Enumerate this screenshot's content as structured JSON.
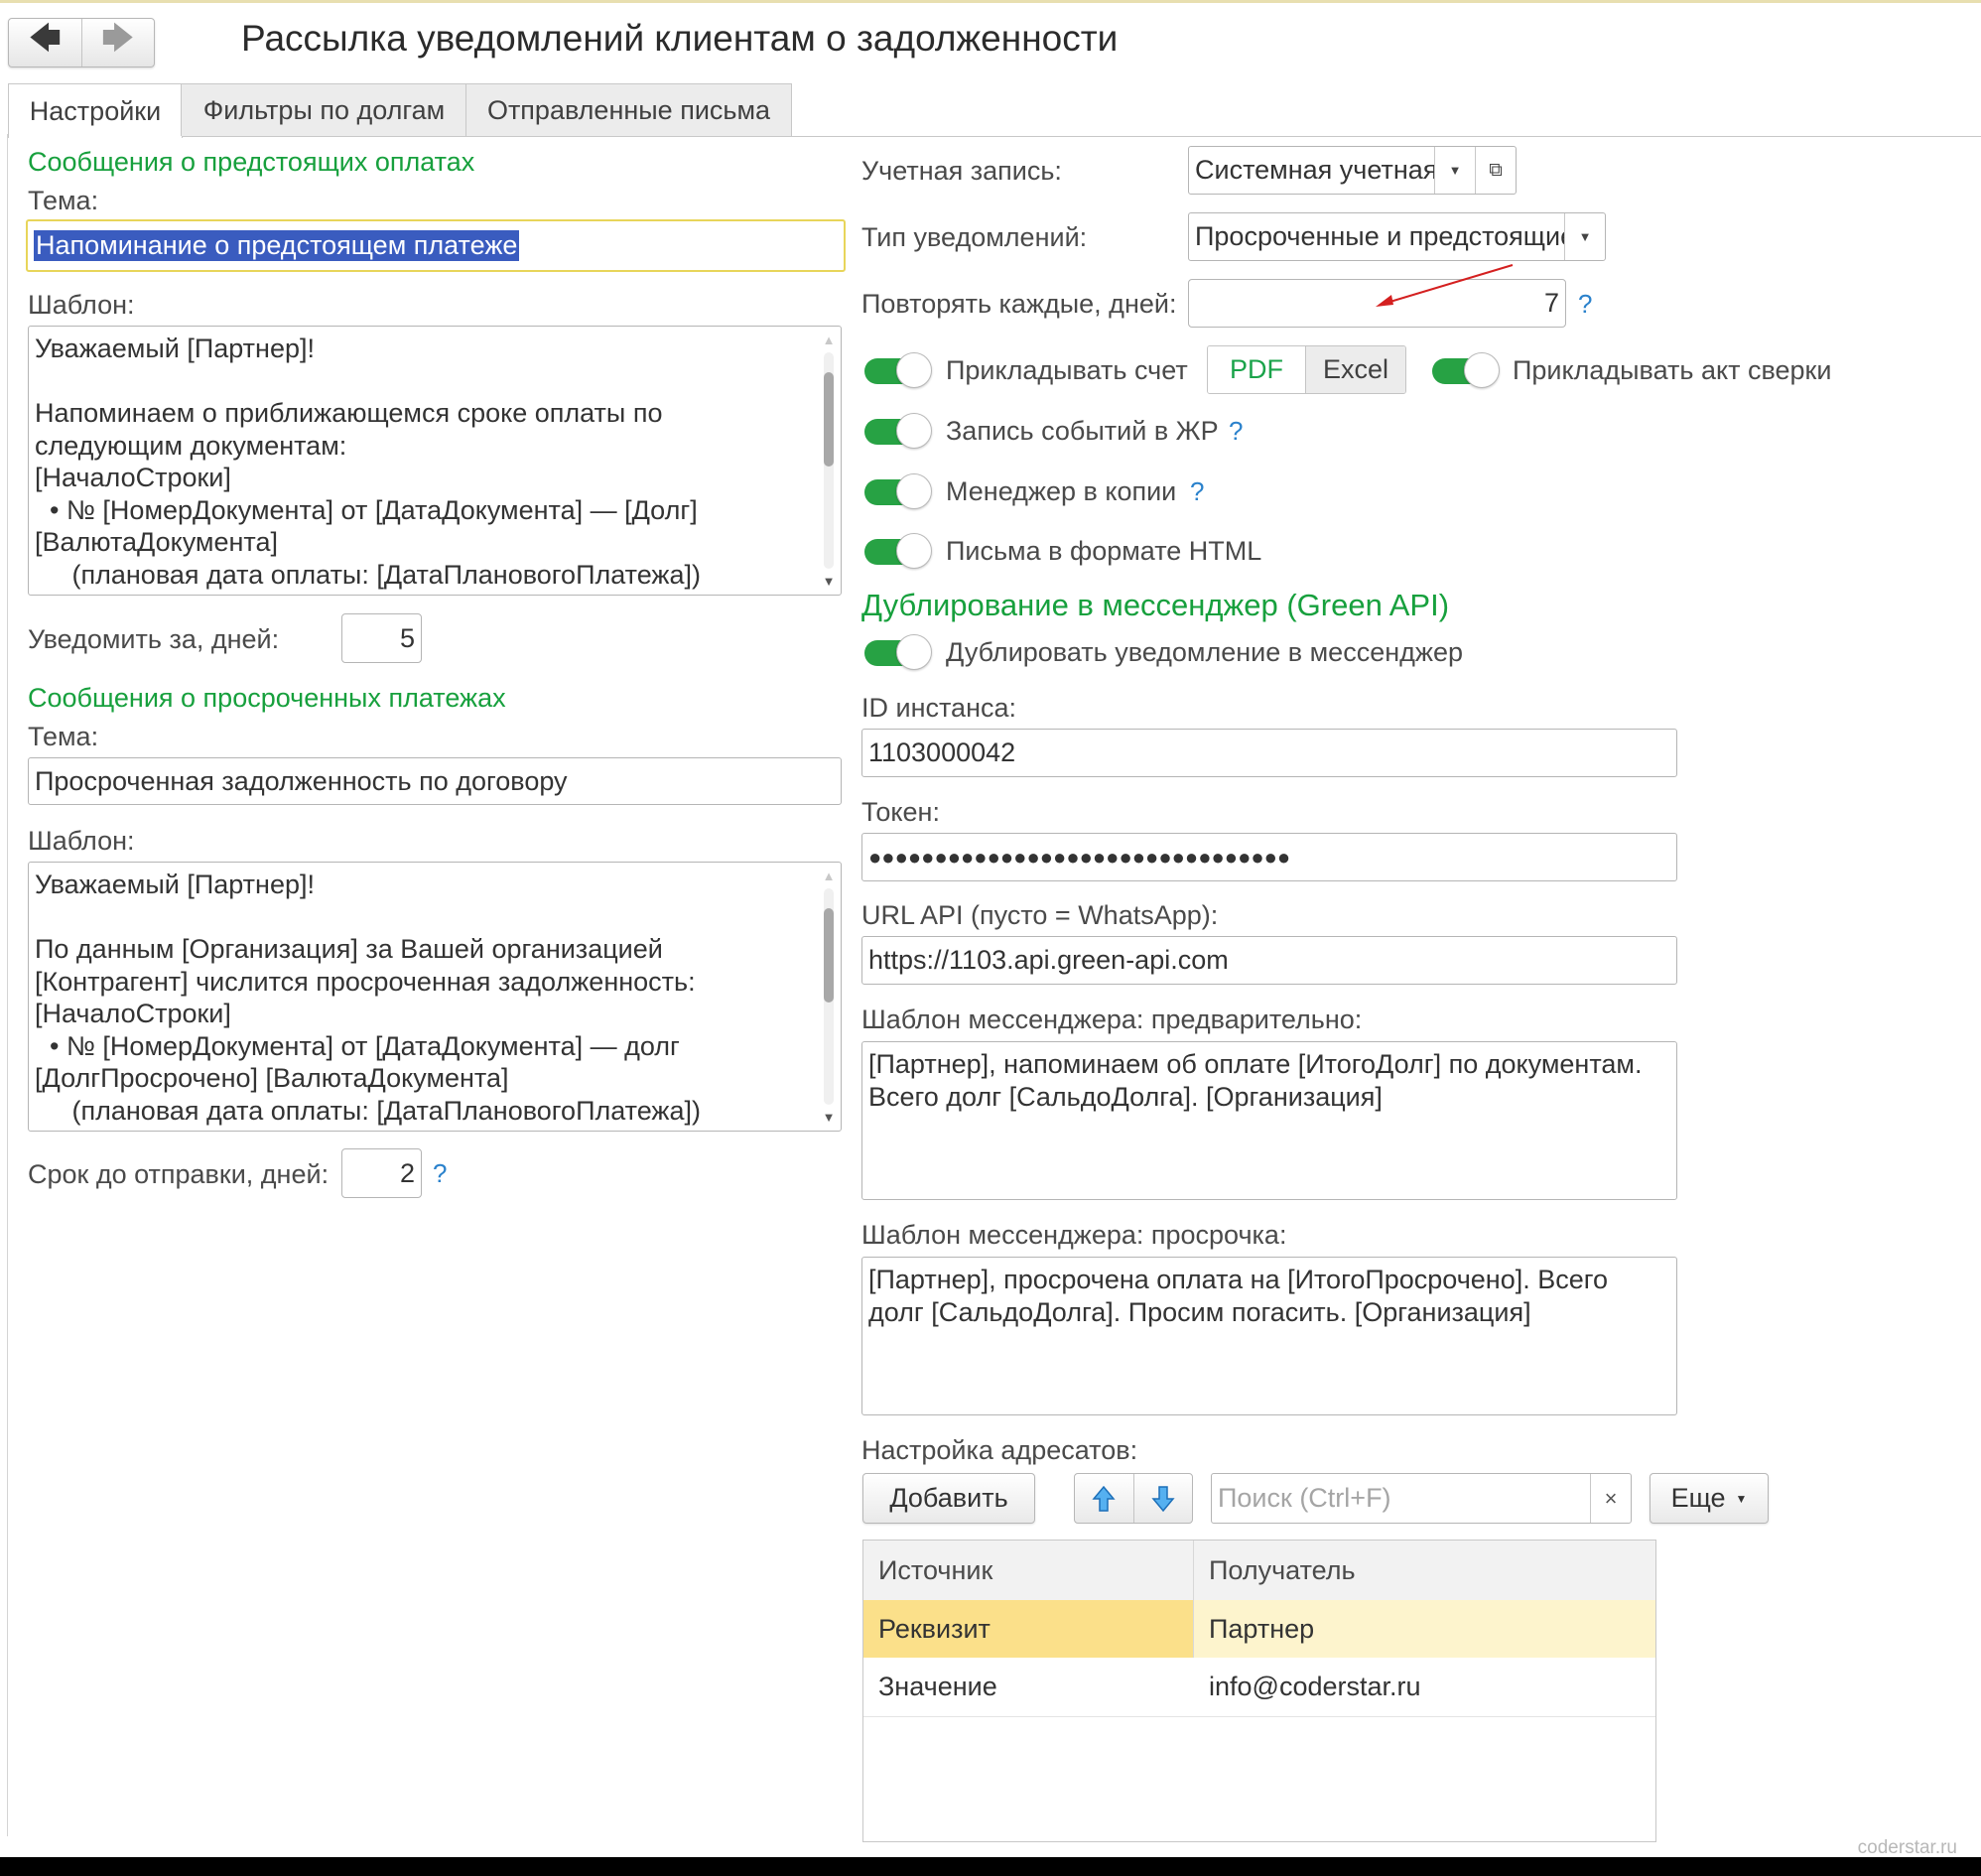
{
  "window": {
    "title": "Рассылка уведомлений клиентам о задолженности",
    "watermark": "coderstar.ru"
  },
  "tabs": [
    {
      "label": "Настройки",
      "active": true
    },
    {
      "label": "Фильтры по долгам",
      "active": false
    },
    {
      "label": "Отправленные письма",
      "active": false
    }
  ],
  "upcoming": {
    "section_title": "Сообщения о предстоящих оплатах",
    "subject_label": "Тема:",
    "subject_value": "Напоминание о предстоящем платеже",
    "template_label": "Шаблон:",
    "template_text": "Уважаемый [Партнер]!\n\nНапоминаем о приближающемся сроке оплаты по\nследующим документам:\n[НачалоСтроки]\n  • № [НомерДокумента] от [ДатаДокумента] — [Долг]\n[ВалютаДокумента]\n     (плановая дата оплаты: [ДатаПлановогоПлатежа])",
    "notify_days_label": "Уведомить за, дней:",
    "notify_days_value": "5"
  },
  "overdue": {
    "section_title": "Сообщения о просроченных платежах",
    "subject_label": "Тема:",
    "subject_value": "Просроченная задолженность по договору",
    "template_label": "Шаблон:",
    "template_text": "Уважаемый [Партнер]!\n\nПо данным [Организация] за Вашей организацией\n[Контрагент] числится просроченная задолженность:\n[НачалоСтроки]\n  • № [НомерДокумента] от [ДатаДокумента] — долг\n[ДолгПросрочено] [ВалютаДокумента]\n     (плановая дата оплаты: [ДатаПлановогоПлатежа])",
    "send_days_label": "Срок до отправки, дней:",
    "send_days_value": "2",
    "help": "?"
  },
  "settings": {
    "account_label": "Учетная запись:",
    "account_value": "Системная учетная запись",
    "type_label": "Тип уведомлений:",
    "type_value": "Просроченные и предстоящие",
    "repeat_label": "Повторять каждые, дней:",
    "repeat_value": "7",
    "help": "?",
    "attach_invoice_label": "Прикладывать счет",
    "format_pdf": "PDF",
    "format_excel": "Excel",
    "attach_act_label": "Прикладывать акт сверки",
    "log_label": "Запись событий в ЖР",
    "manager_copy_label": "Менеджер в копии",
    "html_label": "Письма в формате HTML"
  },
  "messenger": {
    "section_title": "Дублирование в мессенджер (Green API)",
    "duplicate_label": "Дублировать уведомление в мессенджер",
    "instance_label": "ID инстанса:",
    "instance_value": "1103000042",
    "token_label": "Токен:",
    "token_value": "●●●●●●●●●●●●●●●●●●●●●●●●●●●●●●●●",
    "url_label": "URL API (пусто = WhatsApp):",
    "url_value": "https://1103.api.green-api.com",
    "tpl_pre_label": "Шаблон мессенджера: предварительно:",
    "tpl_pre_text": "[Партнер], напоминаем об оплате [ИтогоДолг] по документам.\nВсего долг [СальдоДолга]. [Организация]",
    "tpl_overdue_label": "Шаблон мессенджера: просрочка:",
    "tpl_overdue_text": "[Партнер], просрочена оплата на [ИтогоПросрочено]. Всего\nдолг [СальдоДолга]. Просим погасить. [Организация]"
  },
  "recipients": {
    "label": "Настройка адресатов:",
    "add_button": "Добавить",
    "search_placeholder": "Поиск (Ctrl+F)",
    "clear": "×",
    "more_button": "Еще",
    "columns": [
      "Источник",
      "Получатель"
    ],
    "rows": [
      {
        "source": "Реквизит",
        "recipient": "Партнер"
      },
      {
        "source": "Значение",
        "recipient": "info@coderstar.ru"
      }
    ]
  },
  "colors": {
    "accent_green": "#17a03d",
    "toggle_on": "#27a244",
    "selection": "#3a5cbf",
    "row_highlight": "#fbe08a",
    "help": "#2b82cc",
    "annotation_arrow": "#d42020"
  }
}
